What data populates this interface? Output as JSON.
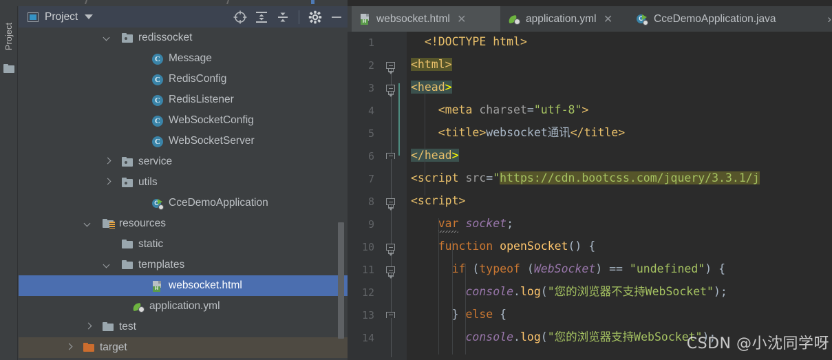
{
  "window": {
    "accent_blue": "#4b6eaf",
    "panel_bg": "#3c3f41",
    "editor_bg": "#2b2b2b"
  },
  "tool_strip": {
    "vertical_tab_label": "Project",
    "folder_icon": "folder-icon"
  },
  "project_panel": {
    "title": "Project",
    "window_icon": "project-window-icon",
    "caret_icon": "chevron-down-icon",
    "tools": [
      {
        "name": "locate-in-tree-icon",
        "label": "Select Opened File"
      },
      {
        "name": "expand-all-icon",
        "label": "Expand All"
      },
      {
        "name": "collapse-all-icon",
        "label": "Collapse All"
      },
      {
        "name": "gear-icon",
        "label": "Settings"
      },
      {
        "name": "minimize-icon",
        "label": "Hide"
      }
    ],
    "tree": [
      {
        "label": "redissocket",
        "indent": 150,
        "icon": "package-icon",
        "arrow": "down",
        "state": "normal"
      },
      {
        "label": "Message",
        "indent": 194,
        "icon": "class-icon",
        "arrow": "none",
        "state": "normal"
      },
      {
        "label": "RedisConfig",
        "indent": 194,
        "icon": "class-icon",
        "arrow": "none",
        "state": "normal"
      },
      {
        "label": "RedisListener",
        "indent": 194,
        "icon": "class-icon",
        "arrow": "none",
        "state": "normal"
      },
      {
        "label": "WebSocketConfig",
        "indent": 194,
        "icon": "class-icon",
        "arrow": "none",
        "state": "normal"
      },
      {
        "label": "WebSocketServer",
        "indent": 194,
        "icon": "class-icon",
        "arrow": "none",
        "state": "normal"
      },
      {
        "label": "service",
        "indent": 150,
        "icon": "package-icon",
        "arrow": "right",
        "state": "normal"
      },
      {
        "label": "utils",
        "indent": 150,
        "icon": "package-icon",
        "arrow": "right",
        "state": "normal"
      },
      {
        "label": "CceDemoApplication",
        "indent": 194,
        "icon": "spring-run-icon",
        "arrow": "none",
        "state": "normal"
      },
      {
        "label": "resources",
        "indent": 122,
        "icon": "resources-icon",
        "arrow": "down",
        "state": "normal"
      },
      {
        "label": "static",
        "indent": 150,
        "icon": "folder-icon",
        "arrow": "none",
        "state": "normal"
      },
      {
        "label": "templates",
        "indent": 150,
        "icon": "folder-icon",
        "arrow": "down",
        "state": "normal"
      },
      {
        "label": "websocket.html",
        "indent": 194,
        "icon": "html-file-icon",
        "arrow": "none",
        "state": "selected"
      },
      {
        "label": "application.yml",
        "indent": 166,
        "icon": "spring-yml-icon",
        "arrow": "none",
        "state": "normal"
      },
      {
        "label": "test",
        "indent": 122,
        "icon": "folder-icon",
        "arrow": "right",
        "state": "normal"
      },
      {
        "label": "target",
        "indent": 94,
        "icon": "folder-icon-orange",
        "arrow": "right",
        "state": "hovered"
      }
    ]
  },
  "editor": {
    "tabs": [
      {
        "label": "websocket.html",
        "icon": "html-file-icon",
        "active": true,
        "closable": true
      },
      {
        "label": "application.yml",
        "icon": "spring-yml-icon",
        "active": false,
        "closable": true
      },
      {
        "label": "CceDemoApplication.java",
        "icon": "spring-run-icon",
        "active": false,
        "closable": false
      }
    ],
    "tab_overflow_icon": "chevron-right-icon",
    "line_numbers": [
      1,
      2,
      3,
      4,
      5,
      6,
      7,
      8,
      9,
      10,
      11,
      12,
      13,
      14
    ],
    "lines": [
      {
        "n": 1,
        "indent": 1,
        "segments": [
          {
            "t": "<!DOCTYPE html>",
            "c": "tok-doctype"
          }
        ]
      },
      {
        "n": 2,
        "indent": 0,
        "segments": [
          {
            "t": "<html>",
            "c": "tok-tag",
            "hl": "hl-olive"
          }
        ]
      },
      {
        "n": 3,
        "indent": 0,
        "segments": [
          {
            "t": "<head",
            "c": "tok-tag",
            "hl": "hl-teal"
          },
          {
            "t": ">",
            "c": "tok-caret",
            "hl": "hl-teal"
          }
        ]
      },
      {
        "n": 4,
        "indent": 2,
        "segments": [
          {
            "t": "<meta ",
            "c": "tok-tag"
          },
          {
            "t": "charset",
            "c": "tok-attr"
          },
          {
            "t": "=",
            "c": "tok-eq"
          },
          {
            "t": "\"utf-8\"",
            "c": "tok-str"
          },
          {
            "t": ">",
            "c": "tok-tag"
          }
        ]
      },
      {
        "n": 5,
        "indent": 2,
        "segments": [
          {
            "t": "<title>",
            "c": "tok-tag"
          },
          {
            "t": "websocket通讯",
            "c": "tok-txt"
          },
          {
            "t": "</title>",
            "c": "tok-tag"
          }
        ]
      },
      {
        "n": 6,
        "indent": 0,
        "segments": [
          {
            "t": "</head",
            "c": "tok-tag",
            "hl": "hl-teal"
          },
          {
            "t": ">",
            "c": "tok-caret",
            "hl": "hl-teal"
          }
        ]
      },
      {
        "n": 7,
        "indent": 0,
        "segments": [
          {
            "t": "<script ",
            "c": "tok-tag"
          },
          {
            "t": "src",
            "c": "tok-attr"
          },
          {
            "t": "=",
            "c": "tok-eq"
          },
          {
            "t": "\"",
            "c": "tok-str"
          },
          {
            "t": "https://cdn.bootcss.com/jquery/3.3.1/j",
            "c": "tok-str",
            "hl": "hl-match"
          }
        ]
      },
      {
        "n": 8,
        "indent": 0,
        "segments": [
          {
            "t": "<script>",
            "c": "tok-tag"
          }
        ]
      },
      {
        "n": 9,
        "indent": 2,
        "segments": [
          {
            "t": "var ",
            "c": "tok-kw"
          },
          {
            "t": "socket",
            "c": "tok-it"
          },
          {
            "t": ";",
            "c": "tok-plain"
          }
        ]
      },
      {
        "n": 10,
        "indent": 2,
        "segments": [
          {
            "t": "function ",
            "c": "tok-kw"
          },
          {
            "t": "openSocket",
            "c": "tok-fn"
          },
          {
            "t": "() {",
            "c": "tok-plain"
          }
        ]
      },
      {
        "n": 11,
        "indent": 3,
        "segments": [
          {
            "t": "if ",
            "c": "tok-kw"
          },
          {
            "t": "(",
            "c": "tok-plain"
          },
          {
            "t": "typeof ",
            "c": "tok-kw"
          },
          {
            "t": "(",
            "c": "tok-plain"
          },
          {
            "t": "WebSocket",
            "c": "tok-cls-it"
          },
          {
            "t": ") == ",
            "c": "tok-plain"
          },
          {
            "t": "\"undefined\"",
            "c": "tok-str"
          },
          {
            "t": ") {",
            "c": "tok-plain"
          }
        ]
      },
      {
        "n": 12,
        "indent": 4,
        "segments": [
          {
            "t": "console",
            "c": "tok-it"
          },
          {
            "t": ".",
            "c": "tok-plain"
          },
          {
            "t": "log",
            "c": "tok-fn"
          },
          {
            "t": "(",
            "c": "tok-plain"
          },
          {
            "t": "\"您的浏览器不支持WebSocket\"",
            "c": "tok-str"
          },
          {
            "t": ");",
            "c": "tok-plain"
          }
        ]
      },
      {
        "n": 13,
        "indent": 3,
        "segments": [
          {
            "t": "} ",
            "c": "tok-plain"
          },
          {
            "t": "else ",
            "c": "tok-kw"
          },
          {
            "t": "{",
            "c": "tok-plain"
          }
        ]
      },
      {
        "n": 14,
        "indent": 4,
        "segments": [
          {
            "t": "console",
            "c": "tok-it"
          },
          {
            "t": ".",
            "c": "tok-plain"
          },
          {
            "t": "log",
            "c": "tok-fn"
          },
          {
            "t": "(",
            "c": "tok-plain"
          },
          {
            "t": "\"您的浏览器支持WebSocket\"",
            "c": "tok-str"
          },
          {
            "t": ");",
            "c": "tok-plain"
          }
        ]
      }
    ],
    "fold_lines": [
      2,
      3,
      6,
      8,
      10,
      11,
      13
    ],
    "fold_end_lines": [
      6,
      13
    ],
    "watermark": "CSDN @小沈同学呀"
  }
}
